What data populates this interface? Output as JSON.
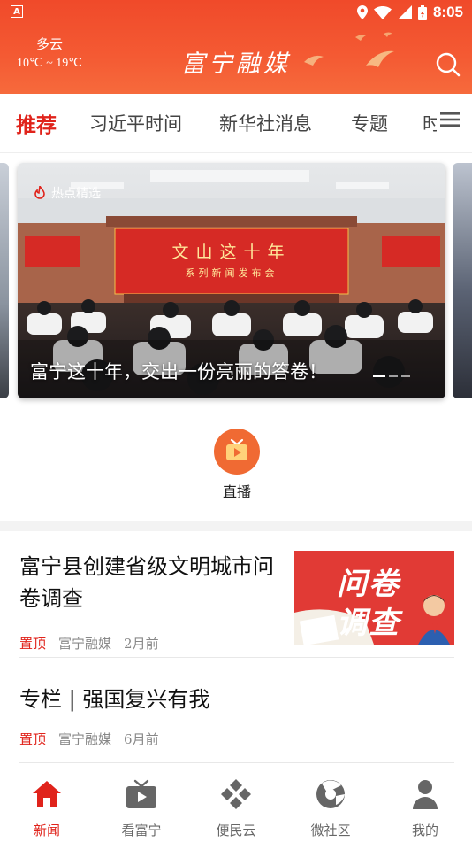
{
  "status_bar": {
    "time": "8:05"
  },
  "header": {
    "weather_condition": "多云",
    "weather_temp": "10℃ ~ 19℃",
    "brand_title": "富宁融媒"
  },
  "tabs": [
    {
      "label": "推荐",
      "active": true
    },
    {
      "label": "习近平时间"
    },
    {
      "label": "新华社消息"
    },
    {
      "label": "专题"
    },
    {
      "label": "时"
    }
  ],
  "carousel": {
    "badge": "热点精选",
    "caption": "富宁这十年，交出一份亮丽的答卷！",
    "banner_title": "文山这十年",
    "banner_subtitle": "系列新闻发布会"
  },
  "live": {
    "label": "直播"
  },
  "news": [
    {
      "title": "富宁县创建省级文明城市问卷调查",
      "pin": "置顶",
      "source": "富宁融媒",
      "time": "2月前",
      "thumb_text_1": "问卷",
      "thumb_text_2": "调查"
    },
    {
      "title": "专栏 | 强国复兴有我",
      "pin": "置顶",
      "source": "富宁融媒",
      "time": "6月前"
    }
  ],
  "bottom_nav": [
    {
      "label": "新闻",
      "icon": "home-icon",
      "active": true
    },
    {
      "label": "看富宁",
      "icon": "tv-icon"
    },
    {
      "label": "便民云",
      "icon": "grid-diamond-icon"
    },
    {
      "label": "微社区",
      "icon": "community-icon"
    },
    {
      "label": "我的",
      "icon": "user-icon"
    }
  ],
  "colors": {
    "accent": "#e0231b",
    "header": "#f24e2d",
    "live": "#f06a33"
  }
}
